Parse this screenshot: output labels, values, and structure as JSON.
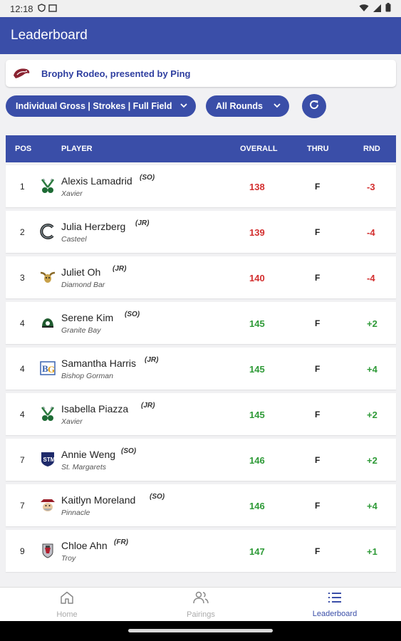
{
  "status_bar": {
    "time": "12:18"
  },
  "app_bar": {
    "title": "Leaderboard"
  },
  "event": {
    "name": "Brophy Rodeo, presented by Ping"
  },
  "filters": {
    "scoring": "Individual Gross | Strokes | Full Field",
    "rounds": "All Rounds"
  },
  "table": {
    "headers": {
      "pos": "POS",
      "player": "PLAYER",
      "overall": "OVERALL",
      "thru": "THRU",
      "rnd": "RND"
    },
    "rows": [
      {
        "pos": "1",
        "name": "Alexis Lamadrid",
        "grade": "(SO)",
        "school": "Xavier",
        "overall": "138",
        "thru": "F",
        "rnd": "-3",
        "overall_color": "red",
        "rnd_color": "red"
      },
      {
        "pos": "2",
        "name": "Julia Herzberg",
        "grade": "(JR)",
        "school": "Casteel",
        "overall": "139",
        "thru": "F",
        "rnd": "-4",
        "overall_color": "red",
        "rnd_color": "red"
      },
      {
        "pos": "3",
        "name": "Juliet Oh",
        "grade": "(JR)",
        "school": "Diamond Bar",
        "overall": "140",
        "thru": "F",
        "rnd": "-4",
        "overall_color": "red",
        "rnd_color": "red"
      },
      {
        "pos": "4",
        "name": "Serene Kim",
        "grade": "(SO)",
        "school": "Granite Bay",
        "overall": "145",
        "thru": "F",
        "rnd": "+2",
        "overall_color": "green",
        "rnd_color": "green"
      },
      {
        "pos": "4",
        "name": "Samantha Harris",
        "grade": "(JR)",
        "school": "Bishop Gorman",
        "overall": "145",
        "thru": "F",
        "rnd": "+4",
        "overall_color": "green",
        "rnd_color": "green"
      },
      {
        "pos": "4",
        "name": "Isabella Piazza",
        "grade": "(JR)",
        "school": "Xavier",
        "overall": "145",
        "thru": "F",
        "rnd": "+2",
        "overall_color": "green",
        "rnd_color": "green"
      },
      {
        "pos": "7",
        "name": "Annie Weng",
        "grade": "(SO)",
        "school": "St. Margarets",
        "overall": "146",
        "thru": "F",
        "rnd": "+2",
        "overall_color": "green",
        "rnd_color": "green"
      },
      {
        "pos": "7",
        "name": "Kaitlyn Moreland",
        "grade": "(SO)",
        "school": "Pinnacle",
        "overall": "146",
        "thru": "F",
        "rnd": "+4",
        "overall_color": "green",
        "rnd_color": "green"
      },
      {
        "pos": "9",
        "name": "Chloe Ahn",
        "grade": "(FR)",
        "school": "Troy",
        "overall": "147",
        "thru": "F",
        "rnd": "+1",
        "overall_color": "green",
        "rnd_color": "green"
      }
    ]
  },
  "bottom_nav": {
    "home": "Home",
    "pairings": "Pairings",
    "leaderboard": "Leaderboard"
  },
  "colors": {
    "primary": "#3a4ea8",
    "under_par": "#d32f2f",
    "over_par": "#2e9a37"
  }
}
